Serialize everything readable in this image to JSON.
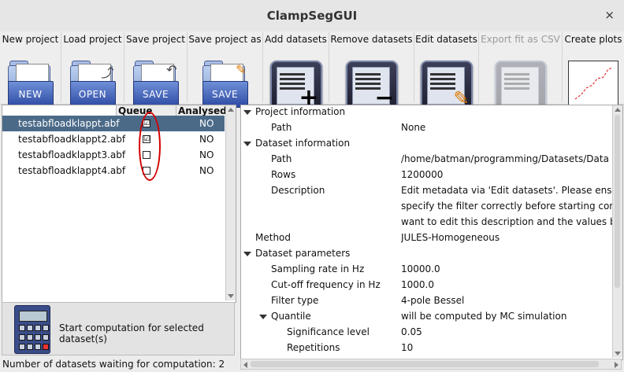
{
  "window": {
    "title": "ClampSegGUI",
    "close_glyph": "×"
  },
  "toolbar": {
    "new_project": {
      "label": "New project",
      "icon_text": "NEW",
      "icon": "new-folder-icon"
    },
    "load_project": {
      "label": "Load project",
      "icon_text": "OPEN",
      "icon": "open-folder-icon"
    },
    "save_project": {
      "label": "Save project",
      "icon_text": "SAVE",
      "icon": "save-folder-icon"
    },
    "save_project_as": {
      "label": "Save project as",
      "icon_text": "SAVE",
      "icon": "save-as-folder-icon"
    },
    "add_datasets": {
      "label": "Add datasets",
      "icon": "add-list-icon"
    },
    "remove_datasets": {
      "label": "Remove datasets",
      "icon": "remove-list-icon"
    },
    "edit_datasets": {
      "label": "Edit datasets",
      "icon": "edit-list-icon"
    },
    "export_fit": {
      "label": "Export fit as CSV",
      "icon": "export-icon",
      "enabled": false
    },
    "create_plots": {
      "label": "Create plots",
      "icon": "plot-icon",
      "plot_axis_y": "Y",
      "plot_axis_x": "×"
    }
  },
  "dataset_table": {
    "columns": [
      "Queue",
      "Analysed"
    ],
    "rows": [
      {
        "name": "testabfloadklappt.abf",
        "queued": true,
        "analysed": "NO",
        "selected": true
      },
      {
        "name": "testabfloadklappt2.abf",
        "queued": true,
        "analysed": "NO",
        "selected": false
      },
      {
        "name": "testabfloadklappt3.abf",
        "queued": false,
        "analysed": "NO",
        "selected": false
      },
      {
        "name": "testabfloadklappt4.abf",
        "queued": false,
        "analysed": "NO",
        "selected": false
      }
    ]
  },
  "compute": {
    "label": "Start computation for selected dataset(s)",
    "icon": "calculator-icon"
  },
  "status": {
    "text": "Number of datasets waiting for computation: 2"
  },
  "properties": {
    "rows": [
      {
        "key": "Project information",
        "value": "",
        "level": 0,
        "expandable": true
      },
      {
        "key": "Path",
        "value": "None",
        "level": 1,
        "expandable": false
      },
      {
        "key": "Dataset information",
        "value": "",
        "level": 0,
        "expandable": true
      },
      {
        "key": "Path",
        "value": "/home/batman/programming/Datasets/Data sets/te",
        "level": 1,
        "expandable": false
      },
      {
        "key": "Rows",
        "value": "1200000",
        "level": 1,
        "expandable": false
      },
      {
        "key": "Description",
        "value": "Edit metadata via 'Edit datasets'. Please ensure th",
        "level": 1,
        "expandable": false
      },
      {
        "key": "",
        "value": "specify the filter correctly before starting computat",
        "level": 1,
        "expandable": false
      },
      {
        "key": "",
        "value": "want to edit this description and the values below.",
        "level": 1,
        "expandable": false
      },
      {
        "key": "Method",
        "value": "JULES-Homogeneous",
        "level": 0,
        "expandable": false
      },
      {
        "key": "Dataset parameters",
        "value": "",
        "level": 0,
        "expandable": true
      },
      {
        "key": "Sampling rate in Hz",
        "value": "10000.0",
        "level": 1,
        "expandable": false
      },
      {
        "key": "Cut-off frequency in Hz",
        "value": "1000.0",
        "level": 1,
        "expandable": false
      },
      {
        "key": "Filter type",
        "value": "4-pole Bessel",
        "level": 1,
        "expandable": false
      },
      {
        "key": "Quantile",
        "value": "will be computed by MC simulation",
        "level": 1,
        "expandable": true
      },
      {
        "key": "Significance level",
        "value": "0.05",
        "level": 2,
        "expandable": false
      },
      {
        "key": "Repetitions",
        "value": "10",
        "level": 2,
        "expandable": false
      }
    ]
  },
  "colors": {
    "selection": "#4b6a88",
    "annotation_oval": "#d40000"
  }
}
